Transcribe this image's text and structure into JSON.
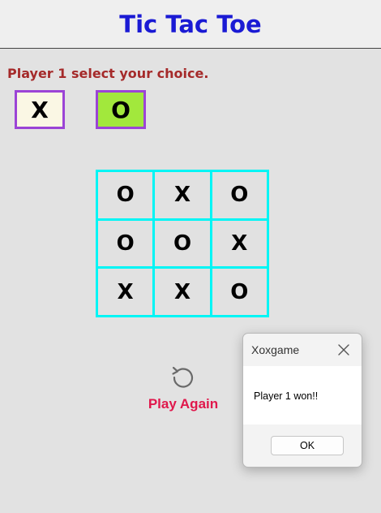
{
  "header": {
    "title": "Tic Tac Toe"
  },
  "prompt": "Player 1 select your choice.",
  "choices": [
    {
      "label": "X",
      "color": "#faf7e4"
    },
    {
      "label": "O",
      "color": "#a2e83c"
    }
  ],
  "board": {
    "cells": [
      "O",
      "X",
      "O",
      "O",
      "O",
      "X",
      "X",
      "X",
      "O"
    ]
  },
  "play_again": {
    "label": "Play Again",
    "icon": "refresh-icon"
  },
  "dialog": {
    "title": "Xoxgame",
    "message": "Player 1 won!!",
    "ok_label": "OK",
    "close_icon": "close-icon"
  },
  "colors": {
    "title": "#1a1ad4",
    "prompt": "#a52a2a",
    "board_border": "#00f5f5",
    "choice_border": "#9b44d6",
    "play_again": "#e0184c"
  }
}
